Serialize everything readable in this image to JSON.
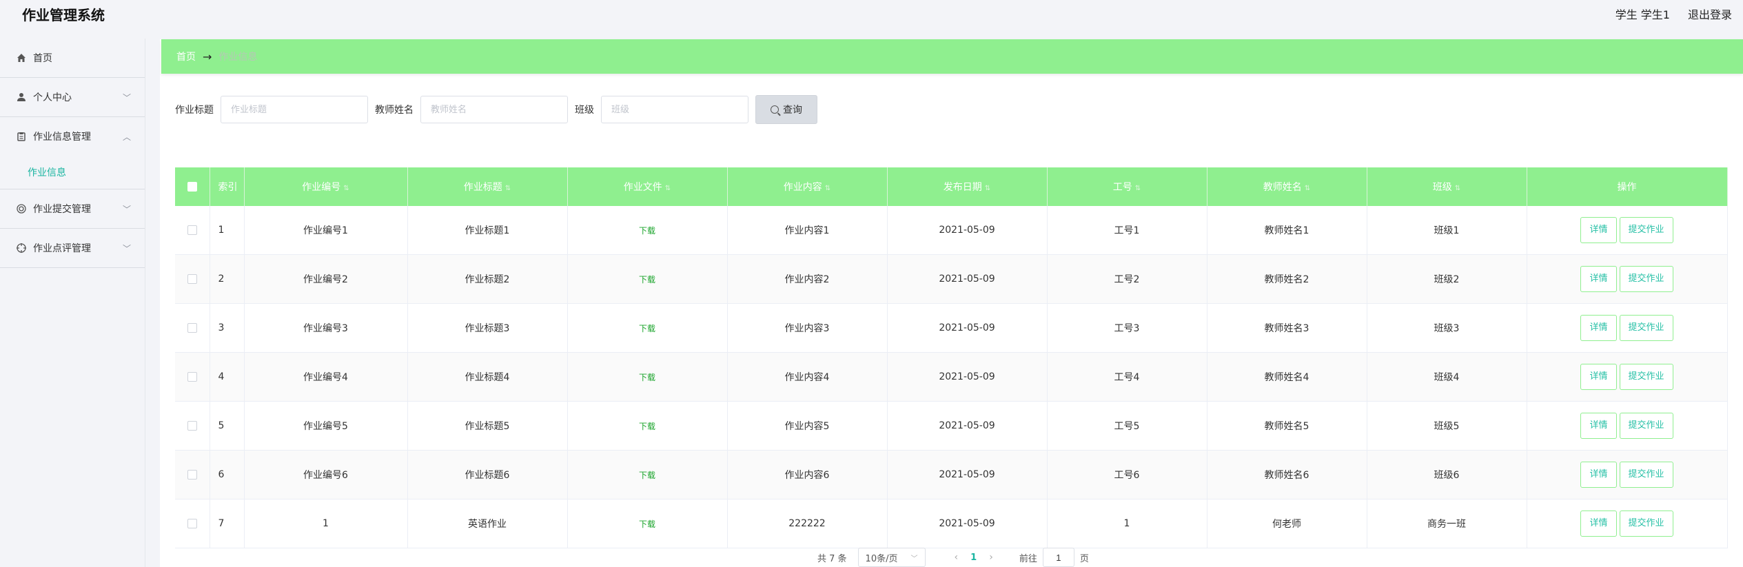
{
  "app": {
    "title": "作业管理系统"
  },
  "header": {
    "user": "学生 学生1",
    "logout": "退出登录"
  },
  "sidebar": {
    "items": [
      {
        "label": "首页",
        "icon": "home-icon"
      },
      {
        "label": "个人中心",
        "icon": "user-icon"
      },
      {
        "label": "作业信息管理",
        "icon": "clipboard-icon",
        "sub": "作业信息"
      },
      {
        "label": "作业提交管理",
        "icon": "circle-icon"
      },
      {
        "label": "作业点评管理",
        "icon": "target-icon"
      }
    ]
  },
  "breadcrumb": {
    "home": "首页",
    "current": "作业信息"
  },
  "filters": {
    "title_label": "作业标题",
    "title_placeholder": "作业标题",
    "teacher_label": "教师姓名",
    "teacher_placeholder": "教师姓名",
    "class_label": "班级",
    "class_placeholder": "班级",
    "search_label": "查询"
  },
  "table": {
    "headers": [
      "索引",
      "作业编号",
      "作业标题",
      "作业文件",
      "作业内容",
      "发布日期",
      "工号",
      "教师姓名",
      "班级",
      "操作"
    ],
    "download_label": "下载",
    "detail_label": "详情",
    "submit_label": "提交作业",
    "rows": [
      {
        "idx": "1",
        "code": "作业编号1",
        "title": "作业标题1",
        "content": "作业内容1",
        "date": "2021-05-09",
        "empno": "工号1",
        "teacher": "教师姓名1",
        "class": "班级1"
      },
      {
        "idx": "2",
        "code": "作业编号2",
        "title": "作业标题2",
        "content": "作业内容2",
        "date": "2021-05-09",
        "empno": "工号2",
        "teacher": "教师姓名2",
        "class": "班级2"
      },
      {
        "idx": "3",
        "code": "作业编号3",
        "title": "作业标题3",
        "content": "作业内容3",
        "date": "2021-05-09",
        "empno": "工号3",
        "teacher": "教师姓名3",
        "class": "班级3"
      },
      {
        "idx": "4",
        "code": "作业编号4",
        "title": "作业标题4",
        "content": "作业内容4",
        "date": "2021-05-09",
        "empno": "工号4",
        "teacher": "教师姓名4",
        "class": "班级4"
      },
      {
        "idx": "5",
        "code": "作业编号5",
        "title": "作业标题5",
        "content": "作业内容5",
        "date": "2021-05-09",
        "empno": "工号5",
        "teacher": "教师姓名5",
        "class": "班级5"
      },
      {
        "idx": "6",
        "code": "作业编号6",
        "title": "作业标题6",
        "content": "作业内容6",
        "date": "2021-05-09",
        "empno": "工号6",
        "teacher": "教师姓名6",
        "class": "班级6"
      },
      {
        "idx": "7",
        "code": "1",
        "title": "英语作业",
        "content": "222222",
        "date": "2021-05-09",
        "empno": "1",
        "teacher": "何老师",
        "class": "商务一班"
      }
    ]
  },
  "pagination": {
    "total": "共 7 条",
    "page_size": "10条/页",
    "current_page": "1",
    "goto_label": "前往",
    "goto_value": "1",
    "page_suffix": "页"
  },
  "colors": {
    "accent_green": "#8fef8f",
    "teal": "#19b4a0"
  }
}
